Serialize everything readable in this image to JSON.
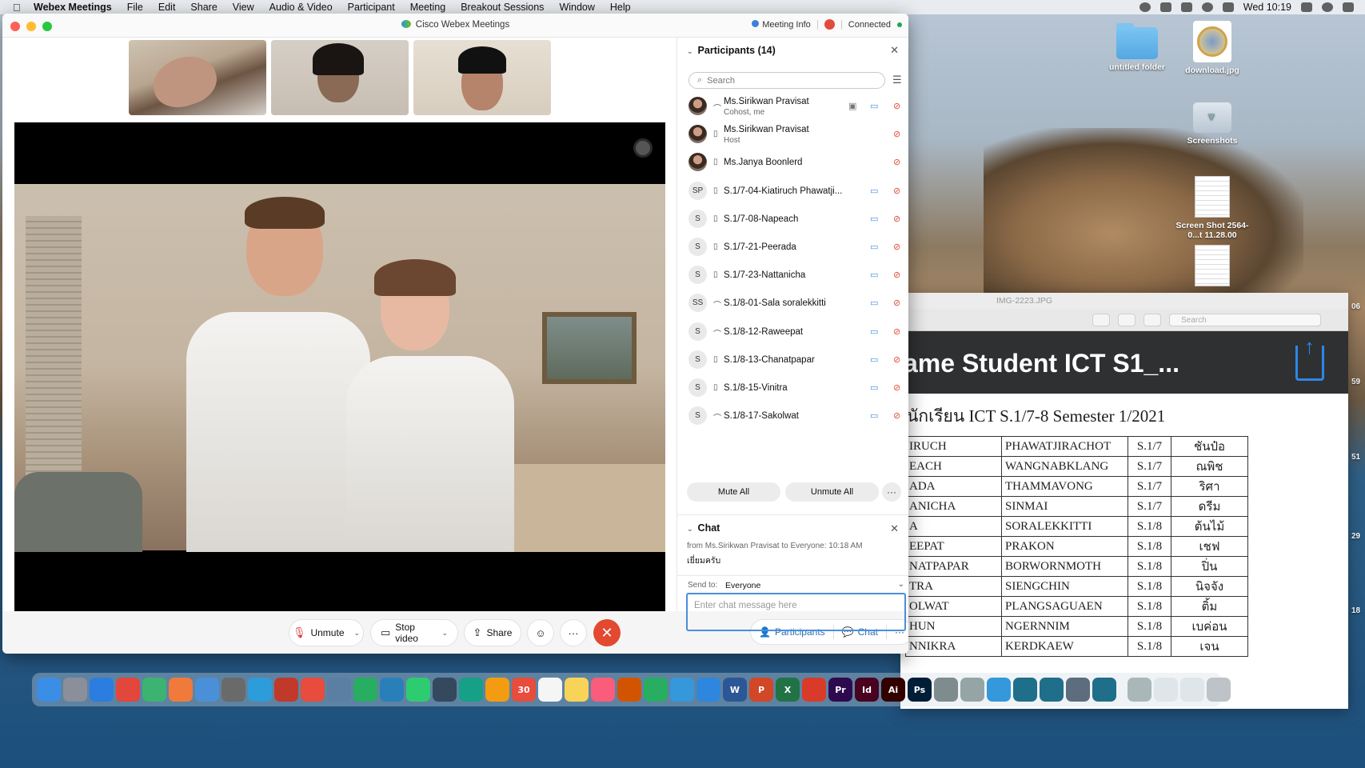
{
  "menubar": {
    "items": [
      "Webex Meetings",
      "File",
      "Edit",
      "Share",
      "View",
      "Audio & Video",
      "Participant",
      "Meeting",
      "Breakout Sessions",
      "Window",
      "Help"
    ],
    "clock": "Wed 10:19"
  },
  "desktop": {
    "icons": [
      {
        "label": "untitled folder"
      },
      {
        "label": "download.jpg"
      },
      {
        "label": "Screenshots"
      },
      {
        "label": "Screen Shot 2564-0...t 11.28.00"
      }
    ],
    "edge_numbers": [
      "06",
      "59",
      "51",
      "29",
      "18"
    ]
  },
  "preview": {
    "window_title": "IMG-2223.JPG",
    "search_placeholder": "Search",
    "banner_title": "ame Student ICT S1_...",
    "sheet_title": "นักเรียน ICT S.1/7-8 Semester 1/2021",
    "rows": [
      [
        "IRUCH",
        "PHAWATJIRACHOT",
        "S.1/7",
        "ชันป๋อ"
      ],
      [
        "EACH",
        "WANGNABKLANG",
        "S.1/7",
        "ณพิช"
      ],
      [
        "ADA",
        "THAMMAVONG",
        "S.1/7",
        "ริศา"
      ],
      [
        "ANICHA",
        "SINMAI",
        "S.1/7",
        "ดรีม"
      ],
      [
        "A",
        "SORALEKKITTI",
        "S.1/8",
        "ต้นไม้"
      ],
      [
        "EEPAT",
        "PRAKON",
        "S.1/8",
        "เชฟ"
      ],
      [
        "NATPAPAR",
        "BORWORNMOTH",
        "S.1/8",
        "ปิ่น"
      ],
      [
        "TRA",
        "SIENGCHIN",
        "S.1/8",
        "นิจจัง"
      ],
      [
        "OLWAT",
        "PLANGSAGUAEN",
        "S.1/8",
        "ติ้ม"
      ],
      [
        "HUN",
        "NGERNNIM",
        "S.1/8",
        "เบค่อน"
      ],
      [
        "NNIKRA",
        "KERDKAEW",
        "S.1/8",
        "เจน"
      ]
    ]
  },
  "webex": {
    "title": "Cisco Webex Meetings",
    "meeting_info": "Meeting Info",
    "status": "Connected",
    "controls": {
      "unmute": "Unmute",
      "stop_video": "Stop video",
      "share": "Share",
      "participants": "Participants",
      "chat": "Chat"
    },
    "participants_panel": {
      "title": "Participants (14)",
      "search_placeholder": "Search",
      "list": [
        {
          "initials": "",
          "name": "Ms.Sirikwan Pravisat",
          "sub": "Cohost, me",
          "photo": true
        },
        {
          "initials": "",
          "name": "Ms.Sirikwan Pravisat",
          "sub": "Host",
          "photo": true
        },
        {
          "initials": "",
          "name": "Ms.Janya Boonlerd",
          "sub": "",
          "photo": true
        },
        {
          "initials": "SP",
          "name": "S.1/7-04-Kiatiruch Phawatji...",
          "sub": ""
        },
        {
          "initials": "S",
          "name": "S.1/7-08-Napeach",
          "sub": ""
        },
        {
          "initials": "S",
          "name": "S.1/7-21-Peerada",
          "sub": ""
        },
        {
          "initials": "S",
          "name": "S.1/7-23-Nattanicha",
          "sub": ""
        },
        {
          "initials": "SS",
          "name": "S.1/8-01-Sala soralekkitti",
          "sub": ""
        },
        {
          "initials": "S",
          "name": "S.1/8-12-Raweepat",
          "sub": ""
        },
        {
          "initials": "S",
          "name": "S.1/8-13-Chanatpapar",
          "sub": ""
        },
        {
          "initials": "S",
          "name": "S.1/8-15-Vinitra",
          "sub": ""
        },
        {
          "initials": "S",
          "name": "S.1/8-17-Sakolwat",
          "sub": ""
        }
      ],
      "mute_all": "Mute All",
      "unmute_all": "Unmute All"
    },
    "chat_panel": {
      "title": "Chat",
      "meta": "from Ms.Sirikwan Pravisat to Everyone:   10:18  AM",
      "message": "เยี่ยมครับ",
      "send_to_label": "Send to:",
      "send_to_value": "Everyone",
      "input_placeholder": "Enter chat message here"
    }
  },
  "dock": {
    "apps": [
      "Finder",
      "Launchpad",
      "Safari",
      "Chrome",
      "App",
      "Swift",
      "Preview",
      "Pen",
      "App",
      "App",
      "App",
      "App",
      "App",
      "App",
      "Messages",
      "App",
      "App",
      "Photos",
      "30",
      "Reminders",
      "Notes",
      "Music",
      "App",
      "Numbers",
      "Keynote",
      "App Store",
      "W",
      "P",
      "X",
      "Acrobat",
      "Pr",
      "Id",
      "Ai",
      "Ps",
      "Settings",
      "App",
      "App",
      "Webex",
      "Webex",
      "App",
      "Webex",
      "App",
      "App",
      "App",
      "Trash"
    ]
  }
}
